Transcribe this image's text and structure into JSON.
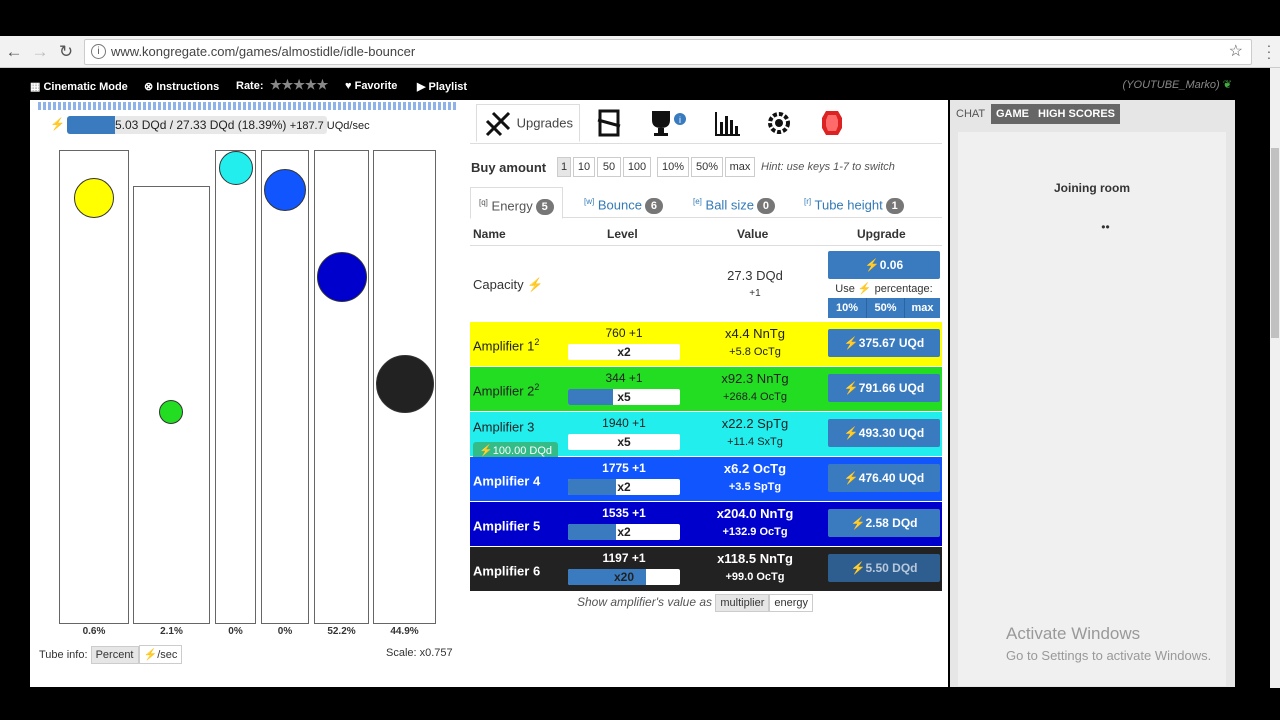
{
  "browser": {
    "url": "www.kongregate.com/games/almostidle/idle-bouncer",
    "back_icon": "←",
    "forward_icon": "→",
    "reload_icon": "↻",
    "info_icon": "i",
    "star_icon": "☆"
  },
  "kong_bar": {
    "cinematic": "Cinematic Mode",
    "instructions": "Instructions",
    "rate": "Rate:",
    "stars": "★★★★★",
    "favorite": "Favorite",
    "playlist": "Playlist",
    "user": "(YOUTUBE_Marko)"
  },
  "energy": {
    "text": "5.03 DQd / 27.33 DQd (18.39%)",
    "rate": "+187.7 UQd/sec",
    "fill_fraction": 0.1839
  },
  "tubes": [
    {
      "pct": "0.6%",
      "ball_color": "#ffff00"
    },
    {
      "pct": "2.1%",
      "ball_color": "#22dd22"
    },
    {
      "pct": "0%",
      "ball_color": "#22eeee"
    },
    {
      "pct": "0%",
      "ball_color": "#1155ff"
    },
    {
      "pct": "52.2%",
      "ball_color": "#0000cc"
    },
    {
      "pct": "44.9%",
      "ball_color": "#222222"
    }
  ],
  "tube_info": {
    "label": "Tube info:",
    "percent": "Percent",
    "per_sec": "⚡/sec",
    "scale": "Scale: x0.757"
  },
  "tabs": {
    "upgrades": "Upgrades"
  },
  "buy": {
    "label": "Buy amount",
    "options": [
      "1",
      "10",
      "50",
      "100",
      "10%",
      "50%",
      "max"
    ],
    "hint": "Hint: use keys 1-7 to switch"
  },
  "subtabs": [
    {
      "key": "[q]",
      "label": "Energy",
      "count": "5"
    },
    {
      "key": "[w]",
      "label": "Bounce",
      "count": "6"
    },
    {
      "key": "[e]",
      "label": "Ball size",
      "count": "0"
    },
    {
      "key": "[r]",
      "label": "Tube height",
      "count": "1"
    }
  ],
  "table": {
    "headers": [
      "Name",
      "Level",
      "Value",
      "Upgrade"
    ],
    "capacity": {
      "name": "Capacity ⚡",
      "value": "27.3 DQd",
      "value_sub": "+1",
      "cost": "⚡0.06",
      "use": "Use ⚡ percentage:",
      "p10": "10%",
      "p50": "50%",
      "pmax": "max"
    },
    "rows": [
      {
        "name": "Amplifier 1",
        "sup": "2",
        "level": "760 +1",
        "mult": "x2",
        "mult_fill": 0,
        "value": "x4.4 NnTg",
        "value_sub": "+5.8 OcTg",
        "cost": "⚡375.67 UQd",
        "bg": "#ffff00",
        "fg": "#222222"
      },
      {
        "name": "Amplifier 2",
        "sup": "2",
        "level": "344 +1",
        "mult": "x5",
        "mult_fill": 0.4,
        "value": "x92.3 NnTg",
        "value_sub": "+268.4 OcTg",
        "cost": "⚡791.66 UQd",
        "bg": "#22dd22",
        "fg": "#222222"
      },
      {
        "name": "Amplifier 3",
        "sup": "",
        "level": "1940 +1",
        "mult": "x5",
        "mult_fill": 0,
        "value": "x22.2 SpTg",
        "value_sub": "+11.4 SxTg",
        "cost": "⚡493.30 UQd",
        "bg": "#22eeee",
        "fg": "#222222",
        "tag": "⚡100.00 DQd"
      },
      {
        "name": "Amplifier 4",
        "sup": "",
        "level": "1775 +1",
        "mult": "x2",
        "mult_fill": 0.43,
        "value": "x6.2 OcTg",
        "value_sub": "+3.5 SpTg",
        "cost": "⚡476.40 UQd",
        "bg": "#1155ff",
        "fg": "#ffffff"
      },
      {
        "name": "Amplifier 5",
        "sup": "",
        "level": "1535 +1",
        "mult": "x2",
        "mult_fill": 0.43,
        "value": "x204.0 NnTg",
        "value_sub": "+132.9 OcTg",
        "cost": "⚡2.58 DQd",
        "bg": "#0000cc",
        "fg": "#ffffff"
      },
      {
        "name": "Amplifier 6",
        "sup": "",
        "level": "1197 +1",
        "mult": "x20",
        "mult_fill": 0.7,
        "value": "x118.5 NnTg",
        "value_sub": "+99.0 OcTg",
        "cost": "⚡5.50 DQd",
        "bg": "#222222",
        "fg": "#ffffff",
        "dim": true
      }
    ]
  },
  "show_as": {
    "label": "Show amplifier's value as",
    "multiplier": "multiplier",
    "energy": "energy"
  },
  "chat": {
    "tab_chat": "CHAT",
    "tab_game": "GAME",
    "tab_scores": "HIGH SCORES",
    "joining": "Joining room",
    "dots": "••"
  },
  "activate": {
    "title": "Activate Windows",
    "sub": "Go to Settings to activate Windows."
  }
}
